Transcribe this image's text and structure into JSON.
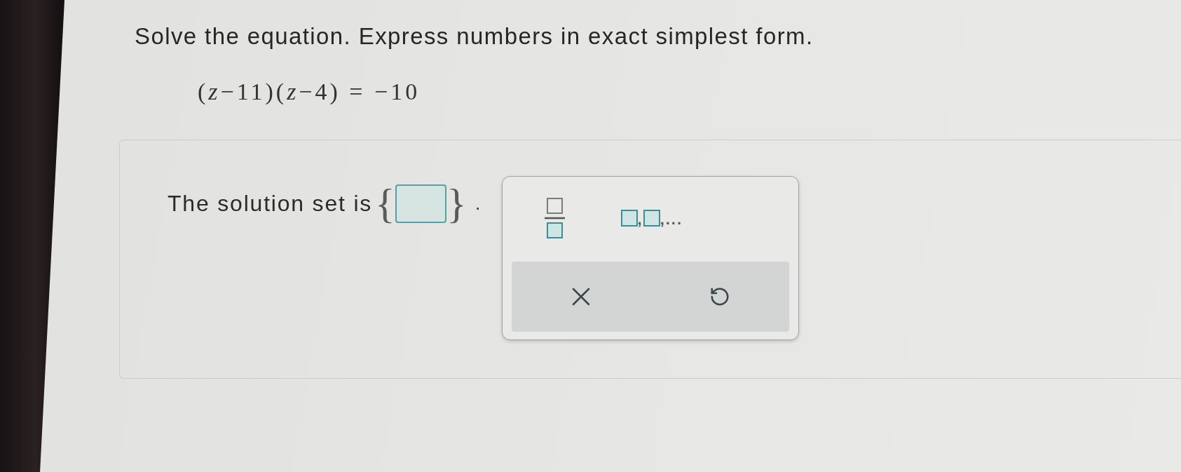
{
  "instruction": "Solve the equation. Express numbers in exact simplest form.",
  "equation": "(*z*−11)(*z*−4) = −10",
  "answer": {
    "label": "The solution set is",
    "open_brace": "{",
    "close_brace": "}",
    "end_mark": "."
  },
  "palette": {
    "tools": [
      {
        "kind": "fraction"
      },
      {
        "kind": "list",
        "separator": ",",
        "tail": ",..."
      }
    ],
    "actions": [
      {
        "kind": "clear"
      },
      {
        "kind": "undo"
      }
    ]
  }
}
